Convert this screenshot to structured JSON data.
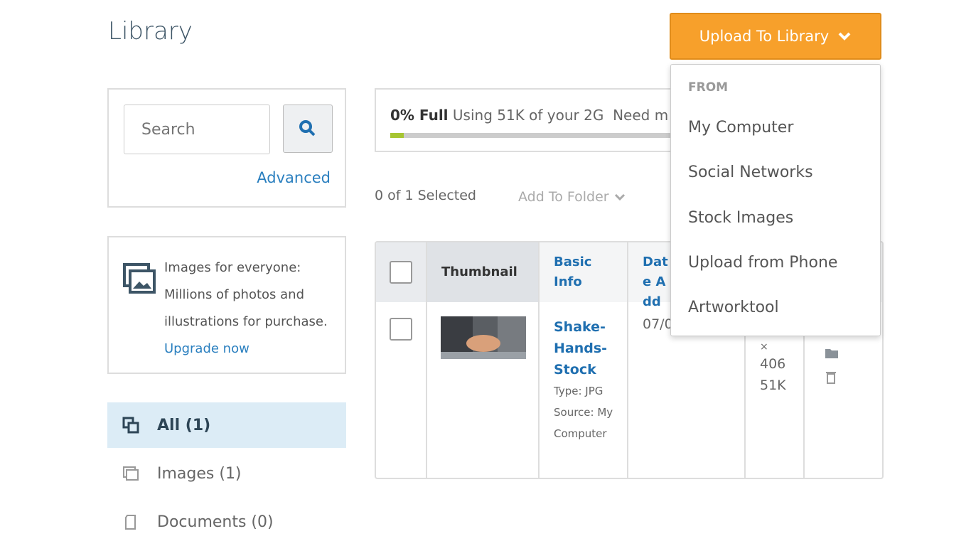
{
  "header": {
    "title": "Library",
    "upload_label": "Upload To Library"
  },
  "search": {
    "placeholder": "Search",
    "advanced": "Advanced"
  },
  "promo": {
    "text": "Images for everyone: Millions of photos and illustrations for purchase.",
    "link": "Upgrade now"
  },
  "nav": [
    {
      "label": "All (1)",
      "icon": "all-files-icon",
      "active": true
    },
    {
      "label": "Images (1)",
      "icon": "image-icon"
    },
    {
      "label": "Documents (0)",
      "icon": "document-icon"
    }
  ],
  "storage": {
    "percent_label": "0% Full",
    "usage": "Using 51K of your 2G",
    "cta": "Need m",
    "fill_percent": 0,
    "accent": "#a6c532"
  },
  "toolbar": {
    "selected": "0 of 1 Selected",
    "add_to_folder": "Add To Folder"
  },
  "table": {
    "headers": [
      "Thumbnail",
      "Basic Info",
      "Date Add"
    ],
    "row": {
      "name": "Shake-Hands-Stock",
      "type": "Type: JPG",
      "source": "Source: My Computer",
      "date": "07/0",
      "dims_x": "×",
      "dims_h": "406",
      "size": "51K"
    }
  },
  "dropdown": {
    "heading": "FROM",
    "items": [
      "My Computer",
      "Social Networks",
      "Stock Images",
      "Upload from Phone",
      "Artworktool"
    ]
  },
  "colors": {
    "accent": "#f7a02b",
    "link": "#2a7fbf"
  }
}
